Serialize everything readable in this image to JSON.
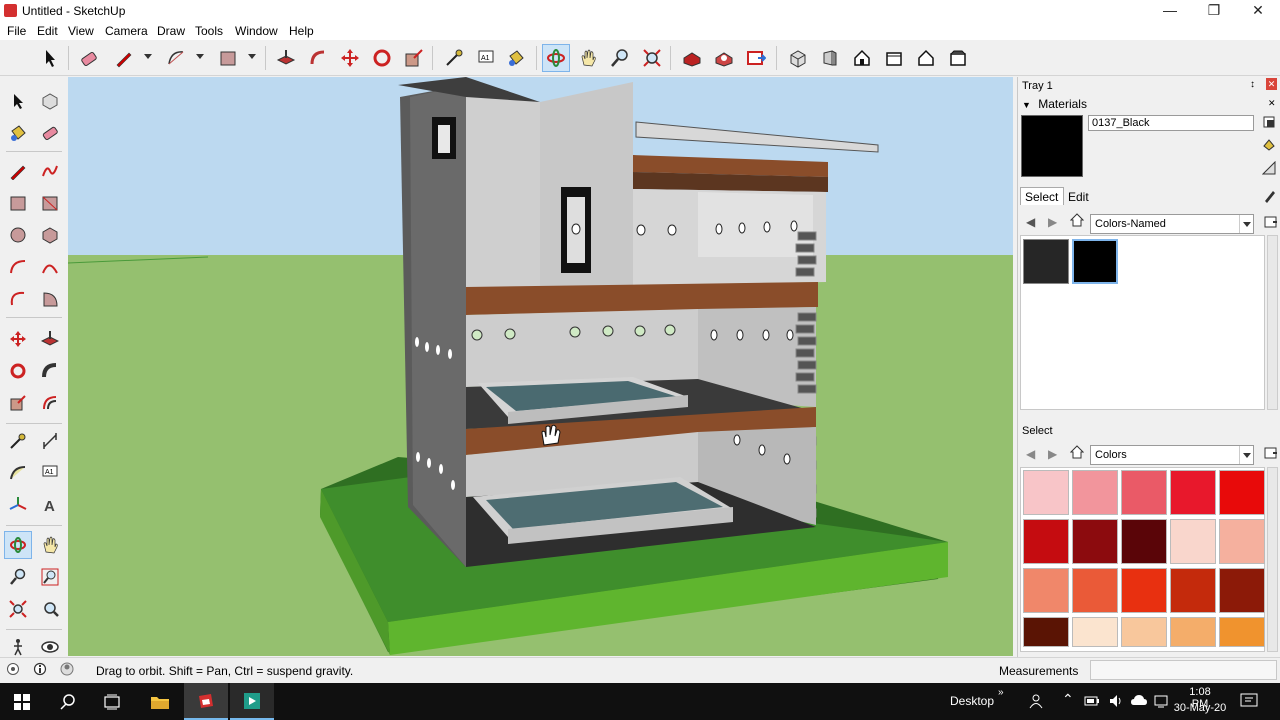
{
  "window": {
    "title": "Untitled - SketchUp",
    "minimize": "—",
    "maximize": "❐",
    "close": "✕"
  },
  "menu": [
    "File",
    "Edit",
    "View",
    "Camera",
    "Draw",
    "Tools",
    "Window",
    "Help"
  ],
  "toolbar_icons": [
    "select-icon",
    "eraser-icon",
    "pencil-icon",
    "arc-icon",
    "rectangle-icon",
    "push-pull-icon",
    "follow-me-icon",
    "move-icon",
    "rotate-icon",
    "scale-icon",
    "tape-measure-icon",
    "text-icon",
    "paint-bucket-icon",
    "orbit-icon",
    "pan-icon",
    "zoom-icon",
    "zoom-extents-icon",
    "warehouse-icon",
    "extension-warehouse-icon",
    "send-to-layout-icon",
    "iso-view-icon",
    "right-view-icon",
    "front-view-icon",
    "top-view-icon",
    "back-view-icon",
    "left-view-icon"
  ],
  "left_tools": [
    "select-icon",
    "component-icon",
    "paint-bucket-icon",
    "eraser-icon",
    "pencil-icon",
    "freehand-icon",
    "rectangle-icon",
    "rotated-rectangle-icon",
    "circle-icon",
    "polygon-icon",
    "arc-icon",
    "two-point-arc-icon",
    "three-point-arc-icon",
    "pie-icon",
    "move-icon",
    "push-pull-icon",
    "rotate-icon",
    "follow-me-icon",
    "scale-icon",
    "offset-icon",
    "tape-measure-icon",
    "dimension-icon",
    "protractor-icon",
    "text-icon",
    "axes-icon",
    "3d-text-icon",
    "orbit-icon",
    "pan-icon",
    "zoom-icon",
    "zoom-window-icon",
    "zoom-extents-icon",
    "previous-view-icon",
    "walk-icon",
    "look-around-icon"
  ],
  "tray": {
    "title": "Tray 1",
    "pin": "↕",
    "close": "✕",
    "materials_title": "Materials",
    "material_name": "0137_Black",
    "tab_select": "Select",
    "tab_edit": "Edit",
    "library_top": "Colors-Named",
    "library_bottom": "Colors",
    "bottom_label": "Select",
    "top_swatches": [
      "#262626",
      "#000000"
    ],
    "color_swatches": [
      "#f8c5c8",
      "#f2959c",
      "#ea5a67",
      "#e8182c",
      "#e80a0a",
      "#c50c10",
      "#8c0b0e",
      "#5a0508",
      "#f9d6cc",
      "#f5b09e",
      "#f0876a",
      "#ea5a38",
      "#e83010",
      "#c42a0c",
      "#8c1a08",
      "#5a1404",
      "#fbe4cf",
      "#f8c79c",
      "#f4ad6a",
      "#f0932e"
    ]
  },
  "status": {
    "message": "Drag to orbit. Shift = Pan, Ctrl = suspend gravity.",
    "measurements_label": "Measurements",
    "measurements_value": ""
  },
  "taskbar": {
    "desktop_label": "Desktop",
    "time": "1:08 PM",
    "date": "30-May-20"
  },
  "colors": {
    "sky": "#b8d8f2",
    "grass": "#94c06e",
    "base_top": "#3e8a2a",
    "wood": "#8a4d2a",
    "concrete": "#a9a9a9",
    "water": "#4f6f76"
  }
}
